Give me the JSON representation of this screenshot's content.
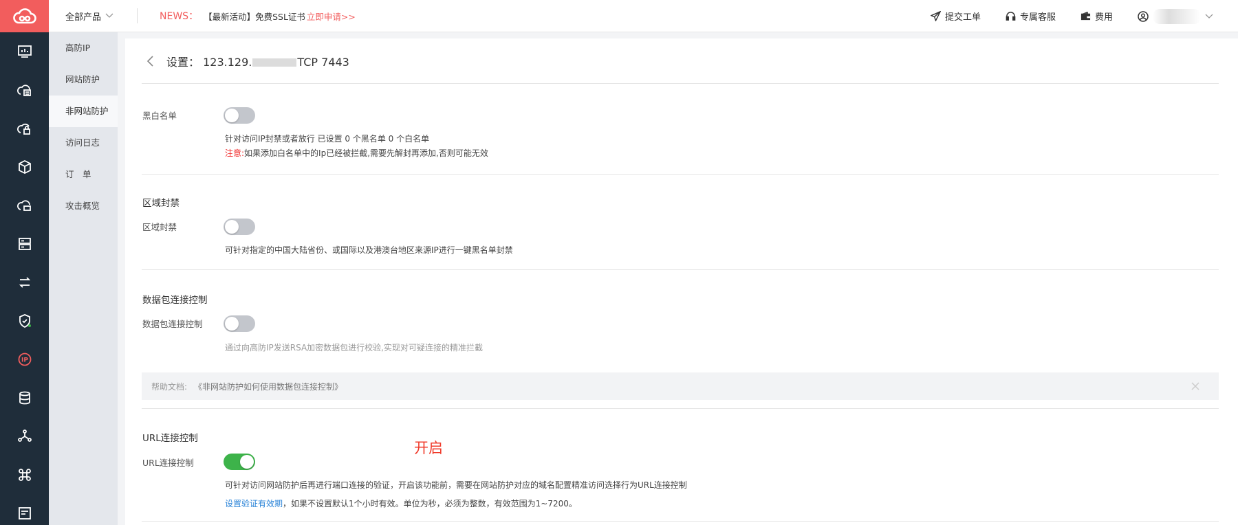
{
  "header": {
    "products_label": "全部产品",
    "news_label": "NEWS：",
    "news_text": "【最新活动】免费SSL证书",
    "news_link": "立即申请>>",
    "actions": [
      {
        "label": "提交工单",
        "icon": "paper-plane-icon"
      },
      {
        "label": "专属客服",
        "icon": "headset-icon"
      },
      {
        "label": "费用",
        "icon": "wallet-icon"
      }
    ]
  },
  "sidebar": {
    "items": [
      {
        "label": "高防IP"
      },
      {
        "label": "网站防护"
      },
      {
        "label": "非网站防护",
        "active": true
      },
      {
        "label": "访问日志"
      },
      {
        "label": "订　单"
      },
      {
        "label": "攻击概览"
      }
    ]
  },
  "page": {
    "title_prefix": "设置：",
    "ip_part1": "123.129.",
    "ip_part2": "TCP 7443"
  },
  "blacklist": {
    "label": "黑白名单",
    "enabled": false,
    "desc": "针对访问IP封禁或者放行 已设置 0 个黑名单 0 个白名单",
    "note_label": "注意:",
    "note_text": "如果添加白名单中的Ip已经被拦截,需要先解封再添加,否则可能无效"
  },
  "region": {
    "title": "区域封禁",
    "label": "区域封禁",
    "enabled": false,
    "desc": "可针对指定的中国大陆省份、或国际以及港澳台地区来源IP进行一键黑名单封禁"
  },
  "packet": {
    "title": "数据包连接控制",
    "label": "数据包连接控制",
    "enabled": false,
    "desc": "通过向高防IP发送RSA加密数据包进行校验,实现对可疑连接的精准拦截",
    "help_label": "帮助文档:",
    "help_link": "《非网站防护如何使用数据包连接控制》"
  },
  "url": {
    "title": "URL连接控制",
    "label": "URL连接控制",
    "enabled": true,
    "desc": "可针对访问网站防护后再进行端口连接的验证，开启该功能前，需要在网站防护对应的域名配置精准访问选择行为URL连接控制",
    "link": "设置验证有效期",
    "link_tail": "，如果不设置默认1个小时有效。单位为秒，必须为整数，有效范围为1~7200。"
  },
  "annotation": "开启",
  "colors": {
    "accent_red": "#f25d5d",
    "sidebar_dark": "#1f2d3a",
    "toggle_on": "#3db34a",
    "link_blue": "#2b84d8"
  }
}
